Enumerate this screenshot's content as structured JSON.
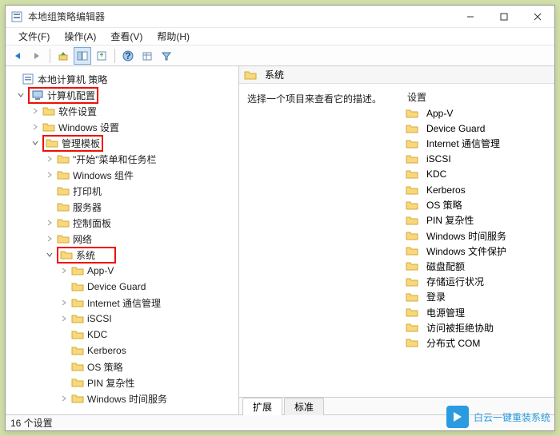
{
  "titlebar": {
    "title": "本地组策略编辑器"
  },
  "menu": {
    "file": "文件(F)",
    "action": "操作(A)",
    "view": "查看(V)",
    "help": "帮助(H)"
  },
  "tree_root": "本地计算机 策略",
  "tree": {
    "computer_config": "计算机配置",
    "software": "软件设置",
    "windows_settings": "Windows 设置",
    "admin_templates": "管理模板",
    "start_taskbar": "\"开始\"菜单和任务栏",
    "win_components": "Windows 组件",
    "printers": "打印机",
    "servers": "服务器",
    "control_panel": "控制面板",
    "network": "网络",
    "system": "系统",
    "appv": "App-V",
    "device_guard": "Device Guard",
    "internet_comm": "Internet 通信管理",
    "iscsi": "iSCSI",
    "kdc": "KDC",
    "kerberos": "Kerberos",
    "os_policy": "OS 策略",
    "pin": "PIN 复杂性",
    "win_time": "Windows 时间服务"
  },
  "right": {
    "header": "系统",
    "desc": "选择一个项目来查看它的描述。",
    "col_header": "设置",
    "items": [
      "App-V",
      "Device Guard",
      "Internet 通信管理",
      "iSCSI",
      "KDC",
      "Kerberos",
      "OS 策略",
      "PIN 复杂性",
      "Windows 时间服务",
      "Windows 文件保护",
      "磁盘配额",
      "存储运行状况",
      "登录",
      "电源管理",
      "访问被拒绝协助",
      "分布式 COM"
    ]
  },
  "tabs": {
    "ext": "扩展",
    "std": "标准"
  },
  "status": "16 个设置",
  "brand": "白云一键重装系统"
}
